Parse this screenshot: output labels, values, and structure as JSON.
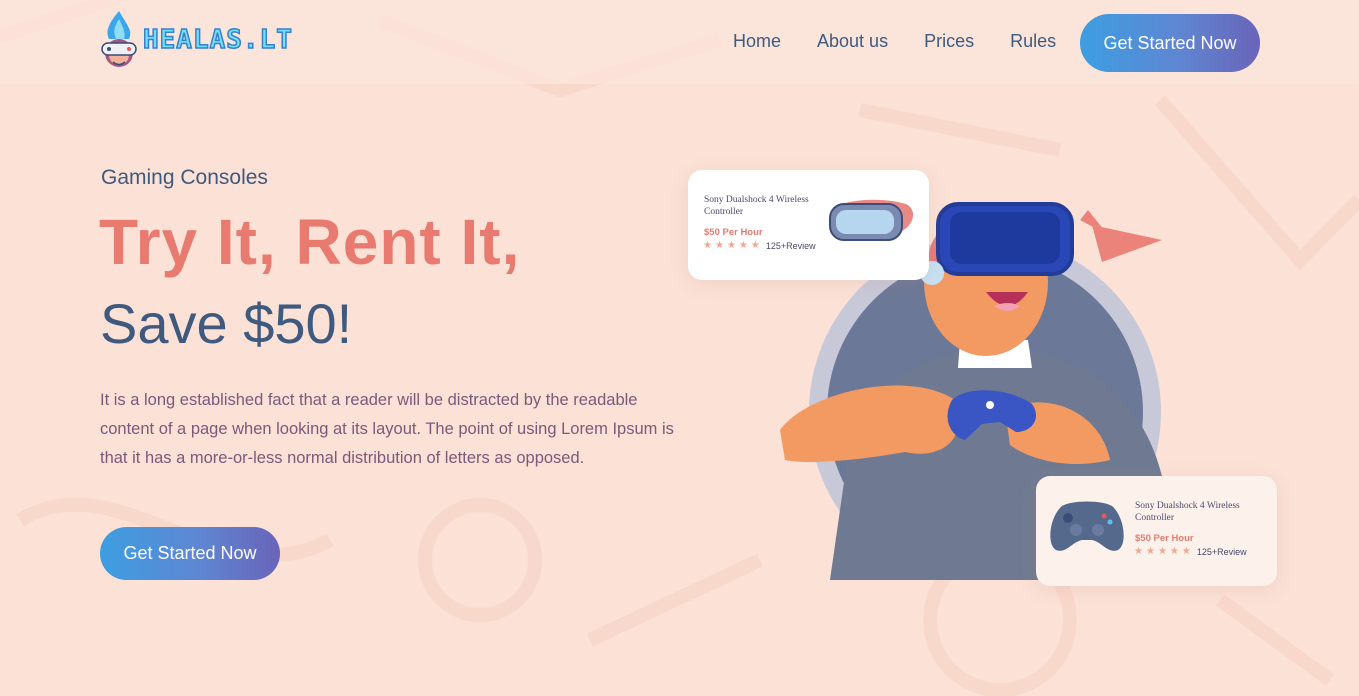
{
  "brand": {
    "logo_text": "HEALAS.LT"
  },
  "nav": {
    "items": [
      {
        "label": "Home"
      },
      {
        "label": "About us"
      },
      {
        "label": "Prices"
      },
      {
        "label": "Rules"
      }
    ],
    "cta_label": "Get Started Now"
  },
  "hero": {
    "subtitle": "Gaming Consoles",
    "title_line1": "Try It, Rent It,",
    "title_line2": "Save $50!",
    "text": "It is a long established fact that a reader will be distracted by the readable content of a page when looking at its layout. The point of using Lorem Ipsum is that it has a more-or-less normal distribution of letters as opposed.",
    "cta_label": "Get Started Now"
  },
  "cards": [
    {
      "title": "Sony Dualshock 4 Wireless Controller",
      "price": "$50 Per Hour",
      "rating": 5,
      "reviews": "125+Review",
      "icon": "vr-headset-icon"
    },
    {
      "title": "Sony Dualshock 4 Wireless Controller",
      "price": "$50 Per Hour",
      "rating": 5,
      "reviews": "125+Review",
      "icon": "gamepad-icon"
    }
  ],
  "colors": {
    "background": "#fbe1d6",
    "accent_coral": "#e97a70",
    "text_navy": "#3f5a7e",
    "button_gradient_start": "#3d9ee1",
    "button_gradient_end": "#6a64b9"
  }
}
